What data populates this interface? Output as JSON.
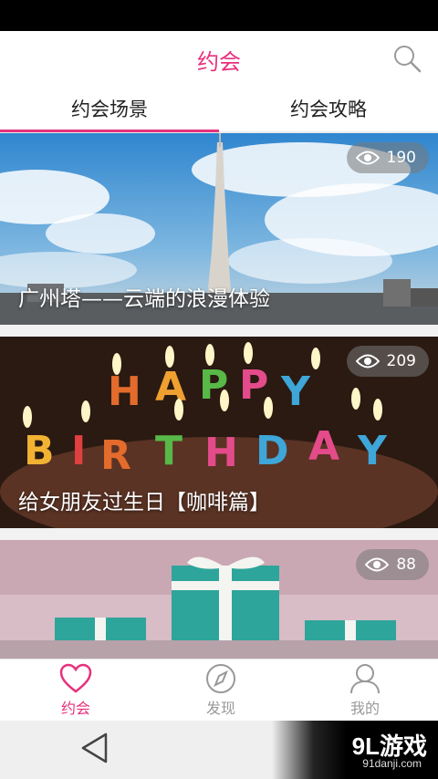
{
  "header": {
    "title": "约会",
    "search_icon": "search-icon"
  },
  "tabs": [
    {
      "label": "约会场景",
      "active": true
    },
    {
      "label": "约会攻略",
      "active": false
    }
  ],
  "cards": [
    {
      "caption": "广州塔——云端的浪漫体验",
      "views": "190"
    },
    {
      "caption": "给女朋友过生日【咖啡篇】",
      "views": "209"
    },
    {
      "caption": "",
      "views": "88"
    }
  ],
  "bottom_nav": [
    {
      "label": "约会",
      "icon": "heart-icon",
      "active": true
    },
    {
      "label": "发现",
      "icon": "compass-icon",
      "active": false
    },
    {
      "label": "我的",
      "icon": "person-icon",
      "active": false
    }
  ],
  "watermark": {
    "main": "9L游戏",
    "sub": "91danji.com"
  },
  "colors": {
    "accent": "#e8307c"
  }
}
